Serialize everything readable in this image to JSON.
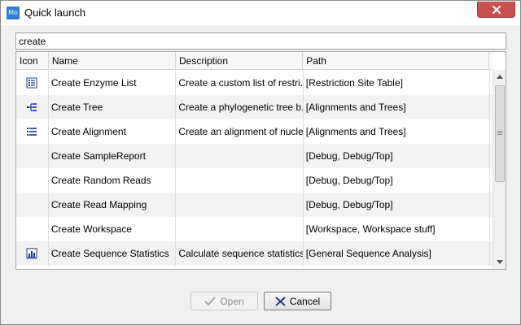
{
  "window": {
    "app_icon_text": "Mo",
    "title": "Quick launch"
  },
  "search": {
    "value": "create"
  },
  "table": {
    "columns": [
      "Icon",
      "Name",
      "Description",
      "Path"
    ],
    "rows": [
      {
        "icon": "enzyme-list-icon",
        "name": "Create Enzyme List",
        "description": "Create a custom list of restri...",
        "path": "[Restriction Site Table]"
      },
      {
        "icon": "tree-icon",
        "name": "Create Tree",
        "description": "Create a phylogenetic tree b...",
        "path": "[Alignments and Trees]"
      },
      {
        "icon": "alignment-icon",
        "name": "Create Alignment",
        "description": "Create an alignment of nucle...",
        "path": "[Alignments and Trees]"
      },
      {
        "icon": "",
        "name": "Create SampleReport",
        "description": "",
        "path": "[Debug, Debug/Top]"
      },
      {
        "icon": "",
        "name": "Create Random Reads",
        "description": "",
        "path": "[Debug, Debug/Top]"
      },
      {
        "icon": "",
        "name": "Create Read Mapping",
        "description": "",
        "path": "[Debug, Debug/Top]"
      },
      {
        "icon": "",
        "name": "Create Workspace",
        "description": "",
        "path": "[Workspace, Workspace stuff]"
      },
      {
        "icon": "sequence-statistics-icon",
        "name": "Create Sequence Statistics",
        "description": "Calculate sequence statistics...",
        "path": "[General Sequence Analysis]"
      }
    ]
  },
  "buttons": {
    "open": "Open",
    "cancel": "Cancel"
  },
  "colors": {
    "close_button": "#c75050",
    "icon_blue": "#1f3a8a",
    "cancel_x": "#1f3a8a"
  }
}
